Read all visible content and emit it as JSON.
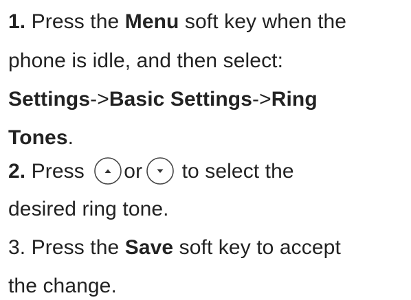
{
  "steps": [
    {
      "line1": {
        "num": "1.",
        "t1": " Press the ",
        "menu": "Menu",
        "t2": " soft key when the"
      },
      "line2": "phone is idle, and then select:",
      "line3": {
        "settings": "Settings",
        "arrow1": "->",
        "basic": "Basic Settings",
        "arrow2": "->",
        "ring": "Ring"
      },
      "line4": {
        "tones": "Tones",
        "period": "."
      }
    },
    {
      "line1": {
        "num": "2.",
        "t1": " Press ",
        "or": "or",
        "t2": " to select the"
      },
      "line2": "desired ring tone."
    },
    {
      "line1": {
        "t1": "3. Press the ",
        "save": "Save",
        "t2": " soft key to accept"
      },
      "line2": "the change."
    }
  ],
  "icons": {
    "up": "up-arrow-key-icon",
    "down": "down-arrow-key-icon"
  },
  "colors": {
    "text": "#222222",
    "icon_stroke": "#444444"
  }
}
